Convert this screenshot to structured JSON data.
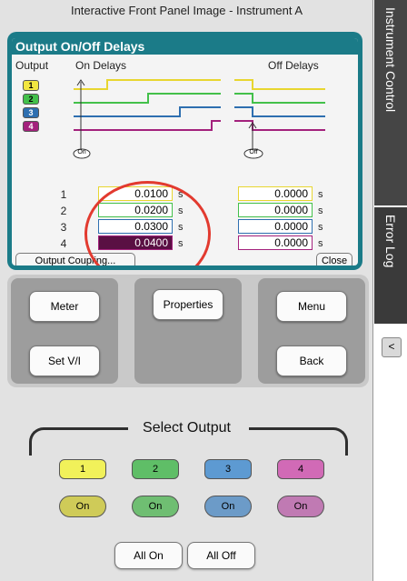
{
  "window": {
    "title": "Interactive Front Panel Image - Instrument A"
  },
  "panel": {
    "title": "Output On/Off Delays",
    "headers": {
      "output": "Output",
      "on_delays": "On Delays",
      "off_delays": "Off Delays"
    },
    "outputs": [
      {
        "label": "1",
        "color": "#f2e640"
      },
      {
        "label": "2",
        "color": "#43c04a"
      },
      {
        "label": "3",
        "color": "#2e6fb0"
      },
      {
        "label": "4",
        "color": "#a3217c"
      }
    ],
    "markers": {
      "on": "On",
      "off": "Off"
    },
    "rows": [
      {
        "label": "1",
        "on": "0.0100",
        "off": "0.0000"
      },
      {
        "label": "2",
        "on": "0.0200",
        "off": "0.0000"
      },
      {
        "label": "3",
        "on": "0.0300",
        "off": "0.0000"
      },
      {
        "label": "4",
        "on": "0.0400",
        "off": "0.0000"
      }
    ],
    "unit": "s",
    "output_coupling_label": "Output Coupling...",
    "close_label": "Close",
    "selected_row": 4,
    "selected_color": "#5a1043"
  },
  "buttons": {
    "meter": "Meter",
    "set_vi": "Set V/I",
    "properties": "Properties",
    "menu": "Menu",
    "back": "Back"
  },
  "select_output": {
    "title": "Select Output",
    "outputs": [
      {
        "label": "1",
        "color": "#f1f15a",
        "on_color": "#cfcb58"
      },
      {
        "label": "2",
        "color": "#5fbe67",
        "on_color": "#6fbe72"
      },
      {
        "label": "3",
        "color": "#5d9ad2",
        "on_color": "#6c9bc8"
      },
      {
        "label": "4",
        "color": "#d16ab6",
        "on_color": "#c07ab3"
      }
    ],
    "on_label": "On",
    "all_on": "All On",
    "all_off": "All Off"
  },
  "side_tabs": {
    "instrument_control": "Instrument Control",
    "error_log": "Error Log",
    "collapse": "<"
  },
  "colors": {
    "display_bezel": "#1b7b88",
    "annotation": "#e23a2f"
  }
}
